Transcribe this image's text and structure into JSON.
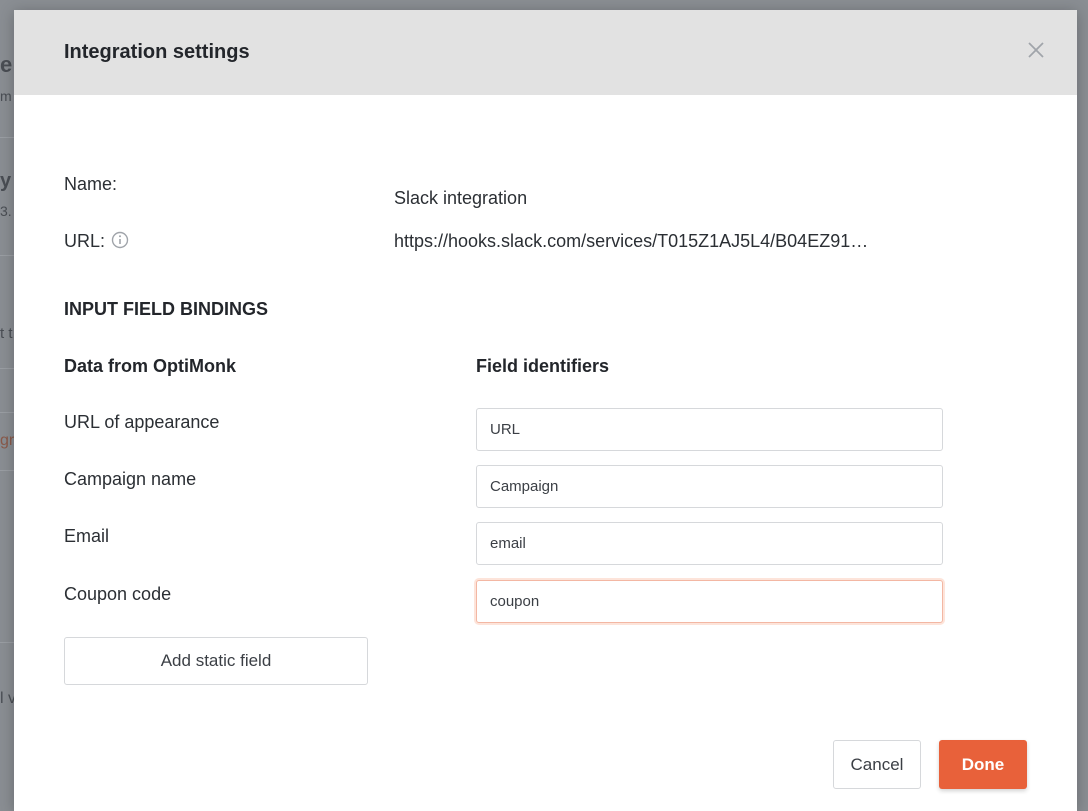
{
  "background": {
    "fragments": [
      "e",
      "m",
      "y",
      "3.",
      "t t",
      "gr",
      "l v"
    ]
  },
  "modal": {
    "title": "Integration settings",
    "close_icon": "close-icon"
  },
  "details": {
    "name_label": "Name:",
    "name_value": "Slack integration",
    "url_label": "URL:",
    "url_value": "https://hooks.slack.com/services/T015Z1AJ5L4/B04EZ91…",
    "info_icon": "info-icon"
  },
  "bindings": {
    "section_title": "INPUT FIELD BINDINGS",
    "col_source": "Data from OptiMonk",
    "col_identifier": "Field identifiers",
    "rows": [
      {
        "source": "URL of appearance",
        "identifier": "URL"
      },
      {
        "source": "Campaign name",
        "identifier": "Campaign"
      },
      {
        "source": "Email",
        "identifier": "email"
      },
      {
        "source": "Coupon code",
        "identifier": "coupon"
      }
    ],
    "add_static_label": "Add static field"
  },
  "footer": {
    "cancel_label": "Cancel",
    "done_label": "Done"
  },
  "colors": {
    "accent": "#e8613a",
    "header_bg": "#e2e2e2",
    "overlay": "#7f8388"
  }
}
